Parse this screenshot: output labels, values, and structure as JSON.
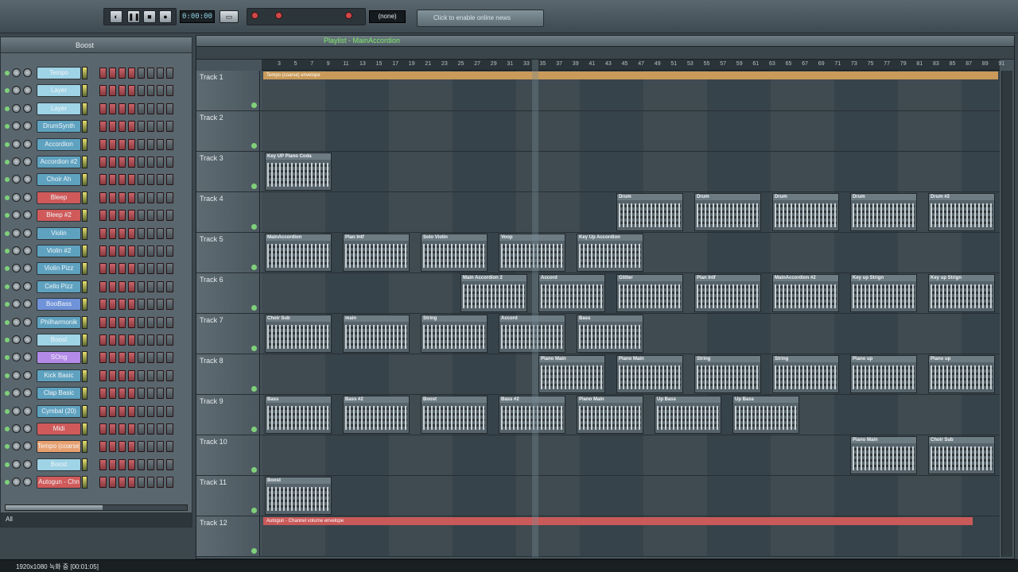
{
  "toolbar": {
    "tempo": "0:00:00",
    "pattern": "(none)",
    "news_hint": "Click to enable online news"
  },
  "rack": {
    "header_label": "Boost",
    "filter": "All",
    "channels": [
      {
        "name": "Tempo",
        "color": "#9fd3e6"
      },
      {
        "name": "Layer",
        "color": "#9fd3e6"
      },
      {
        "name": "Layer",
        "color": "#9fd3e6"
      },
      {
        "name": "DrumSynth",
        "color": "#5fa2c0"
      },
      {
        "name": "Accordion",
        "color": "#5fa2c0"
      },
      {
        "name": "Accordion #2",
        "color": "#5fa2c0"
      },
      {
        "name": "Choir Ah",
        "color": "#5fa2c0"
      },
      {
        "name": "Bleep",
        "color": "#d05a5a"
      },
      {
        "name": "Bleep #2",
        "color": "#d05a5a"
      },
      {
        "name": "Violin",
        "color": "#5fa2c0"
      },
      {
        "name": "Violin #2",
        "color": "#5fa2c0"
      },
      {
        "name": "Violin Pizz",
        "color": "#5fa2c0"
      },
      {
        "name": "Cello Pizz",
        "color": "#5fa2c0"
      },
      {
        "name": "BooBass",
        "color": "#6f92d8"
      },
      {
        "name": "Philharmonik",
        "color": "#5fa2c0"
      },
      {
        "name": "Boost",
        "color": "#9fd3e6"
      },
      {
        "name": "SOng",
        "color": "#b48ae8"
      },
      {
        "name": "Kick Basic",
        "color": "#5fa2c0"
      },
      {
        "name": "Clap Basic",
        "color": "#5fa2c0"
      },
      {
        "name": "Cymbal (20)",
        "color": "#5fa2c0"
      },
      {
        "name": "Midi",
        "color": "#d05a5a"
      },
      {
        "name": "Tempo (coarse)",
        "color": "#e8a070"
      },
      {
        "name": "Boost",
        "color": "#9fd3e6"
      },
      {
        "name": "Autogun - Chn",
        "color": "#d05a5a"
      }
    ]
  },
  "playlist": {
    "title": "Playlist - MainAccordion",
    "ruler": [
      "3",
      "5",
      "7",
      "9",
      "11",
      "13",
      "15",
      "17",
      "19",
      "21",
      "23",
      "25",
      "27",
      "29",
      "31",
      "33",
      "35",
      "37",
      "39",
      "41",
      "43",
      "45",
      "47",
      "49",
      "51",
      "53",
      "55",
      "57",
      "59",
      "61",
      "63",
      "65",
      "67",
      "69",
      "71",
      "73",
      "75",
      "77",
      "79",
      "81",
      "83",
      "85",
      "87",
      "89",
      "91"
    ],
    "tracks": [
      {
        "name": "Track 1",
        "clips": []
      },
      {
        "name": "Track 2",
        "clips": []
      },
      {
        "name": "Track 3",
        "clips": [
          {
            "label": "Key UP Piano Coda"
          }
        ]
      },
      {
        "name": "Track 4",
        "clips": [
          {
            "label": "Drum"
          },
          {
            "label": "Drum"
          },
          {
            "label": "Drum"
          },
          {
            "label": "Drum"
          },
          {
            "label": "Drum #2"
          }
        ]
      },
      {
        "name": "Track 5",
        "clips": [
          {
            "label": "MainAccordion"
          },
          {
            "label": "Plan Intf"
          },
          {
            "label": "Solo Violin"
          },
          {
            "label": "Voop"
          },
          {
            "label": "Key Up Accordion"
          }
        ]
      },
      {
        "name": "Track 6",
        "clips": [
          {
            "label": "Main Accordion 2"
          },
          {
            "label": "Accord"
          },
          {
            "label": "Glitter"
          },
          {
            "label": "Plan Intf"
          },
          {
            "label": "MainAccordion #2"
          },
          {
            "label": "Key up Strign"
          },
          {
            "label": "Key up Strign"
          }
        ]
      },
      {
        "name": "Track 7",
        "clips": [
          {
            "label": "Choir Sub"
          },
          {
            "label": "main"
          },
          {
            "label": "String"
          },
          {
            "label": "Accord"
          },
          {
            "label": "Bass"
          }
        ]
      },
      {
        "name": "Track 8",
        "clips": [
          {
            "label": "Piano Main"
          },
          {
            "label": "Piano Main"
          },
          {
            "label": "String"
          },
          {
            "label": "String"
          },
          {
            "label": "Piano up"
          },
          {
            "label": "Piano up"
          }
        ]
      },
      {
        "name": "Track 9",
        "clips": [
          {
            "label": "Bass"
          },
          {
            "label": "Bass #2"
          },
          {
            "label": "Boost"
          },
          {
            "label": "Bass #2"
          },
          {
            "label": "Piano Main"
          },
          {
            "label": "Up Bass"
          },
          {
            "label": "Up Bass"
          }
        ]
      },
      {
        "name": "Track 10",
        "clips": [
          {
            "label": "Piano Main"
          },
          {
            "label": "Choir Sub"
          }
        ]
      },
      {
        "name": "Track 11",
        "clips": [
          {
            "label": "Boost"
          }
        ]
      },
      {
        "name": "Track 12",
        "clips": []
      }
    ],
    "envelopes": {
      "track1": "Tempo (coarse) envelope",
      "track12": "Autogun - Channel volume envelope"
    }
  },
  "status": {
    "text": "1920x1080  녹화 중 [00:01:05]"
  }
}
